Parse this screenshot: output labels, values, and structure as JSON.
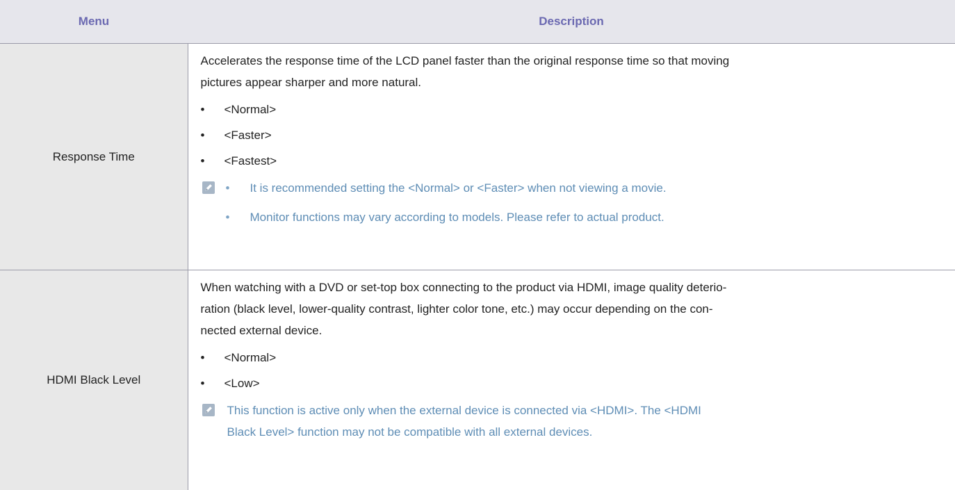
{
  "table": {
    "headers": {
      "menu": "Menu",
      "description": "Description"
    },
    "rows": [
      {
        "menu": "Response Time",
        "intro_line1": "Accelerates the response time of the LCD panel faster than the original response time so that moving",
        "intro_line2": "pictures appear sharper and more natural.",
        "options": [
          "<Normal>",
          "<Faster>",
          "<Fastest>"
        ],
        "notes": [
          "It is recommended setting the <Normal> or <Faster> when not viewing a movie.",
          "Monitor functions may vary according to models. Please refer to actual product."
        ]
      },
      {
        "menu": "HDMI Black Level",
        "intro_line1": "When watching with a DVD or set-top box connecting to the product via HDMI, image quality deterio-",
        "intro_line2": "ration (black level, lower-quality contrast, lighter color tone, etc.) may occur depending on the con-",
        "intro_line3": "nected external device.",
        "options": [
          "<Normal>",
          "<Low>"
        ],
        "note_line1": "This function is active only when the external device is connected via <HDMI>. The <HDMI",
        "note_line2": "Black Level> function may not be compatible with all external devices."
      }
    ]
  },
  "bullet_char": "•",
  "icons": {
    "note": "note-pencil-icon"
  },
  "colors": {
    "header_bg": "#e6e6ec",
    "header_text": "#6b69b1",
    "menu_bg": "#e8e8e8",
    "note_text": "#5e8db5",
    "note_icon": "#a7b6c6"
  }
}
